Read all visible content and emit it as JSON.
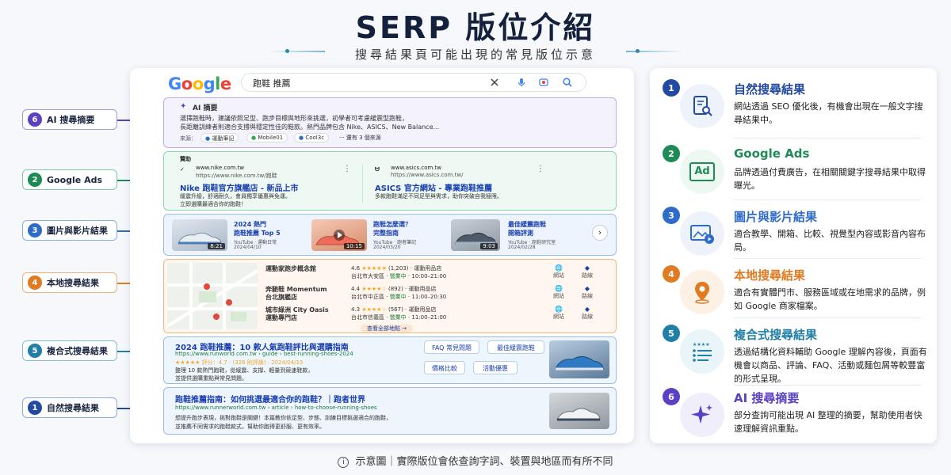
{
  "header": {
    "title": "SERP 版位介紹",
    "subtitle": "搜尋結果頁可能出現的常見版位示意"
  },
  "serp": {
    "logo": "Google",
    "query": "跑鞋 推薦",
    "ai": {
      "heading": "AI 摘要",
      "line1": "選擇跑鞋時，建議依照足型、跑步目標與地形來挑選，初學者可考慮緩震型跑鞋，",
      "line2": "長距離訓練者則適合支撐與穩定性佳的鞋款。熱門品牌包含 Nike、ASICS、New Balance...",
      "sources_label": "來源：",
      "sources": [
        "運動筆記",
        "Mobile01",
        "Cool3c"
      ],
      "more": "還有 3 個來源"
    },
    "ads": {
      "label": "贊助",
      "items": [
        {
          "domain": "www.nike.com.tw",
          "url": "https://www.nike.com.tw/跑鞋",
          "title": "Nike 跑鞋官方旗艦店 - 新品上市",
          "desc1": "緩震升級，舒適耐久，會員獨享優惠與免運。",
          "desc2": "立即選購最適合你的跑鞋！"
        },
        {
          "domain": "www.asics.com.tw",
          "url": "https://www.asics.com.tw/",
          "title": "ASICS 官方網站 - 專業跑鞋推薦",
          "desc1": "多款跑鞋滿足不同足型與需求，助你突破自我極限。",
          "desc2": ""
        }
      ]
    },
    "videos": [
      {
        "title1": "2024 熱門",
        "title2": "跑鞋推薦 Top 5",
        "source": "YouTube · 運動日常",
        "date": "2024/04/10",
        "duration": "8:21"
      },
      {
        "title1": "跑鞋怎麼選？",
        "title2": "完整指南",
        "source": "YouTube · 跑者筆記",
        "date": "2024/03/20",
        "duration": "10:15"
      },
      {
        "title1": "最佳緩震跑鞋",
        "title2": "開箱評測",
        "source": "YouTube · 跑鞋研究室",
        "date": "2024/02/28",
        "duration": "9:03"
      }
    ],
    "local": {
      "places": [
        {
          "name1": "運動家跑步概念館",
          "name2": "",
          "rating": "4.6",
          "stars": "★★★★★",
          "reviews": "(1,203)",
          "type": "運動用品店",
          "addr": "台北市大安區",
          "status": "營業中",
          "hours": "10:00–21:00"
        },
        {
          "name1": "奔馳鞋 Momentum",
          "name2": "台北旗艦店",
          "rating": "4.4",
          "stars": "★★★★☆",
          "reviews": "(892)",
          "type": "運動用品店",
          "addr": "台北市中正區",
          "status": "營業中",
          "hours": "11:00–20:30"
        },
        {
          "name1": "城市綠洲 City Oasis",
          "name2": "運動專門店",
          "rating": "4.3",
          "stars": "★★★★☆",
          "reviews": "(567)",
          "type": "運動用品店",
          "addr": "台北市信義區",
          "status": "營業中",
          "hours": "11:00–21:00"
        }
      ],
      "web": "網站",
      "dir": "路線",
      "more": "查看全部地點 →"
    },
    "rich": {
      "title": "2024 跑鞋推薦：10 款人氣跑鞋評比與選購指南",
      "url": "https://www.runworld.com.tw › guide › best-running-shoes-2024",
      "rating_text": "★★★★★ 評分：4.7 · (326 則評論) · 2024/04/15",
      "desc1": "整理 10 款熱門跑鞋，從緩震、支撐、輕量到競速鞋款，",
      "desc2": "並提供選購重點與常見問題。",
      "chips": [
        "FAQ 常見問題",
        "最佳緩震跑鞋",
        "價格比較",
        "活動優惠"
      ]
    },
    "organic": {
      "title": "跑鞋推薦指南：如何挑選最適合你的跑鞋？｜跑者世界",
      "url": "https://www.runnerworld.com.tw › article › how-to-choose-running-shoes",
      "desc1": "想提升跑步表現，挑對跑鞋是關鍵！本篇教你依足型、步態、訓練目標挑選適合的跑鞋，",
      "desc2": "並推薦不同需求的跑鞋款式，幫助你跑得更舒服、更有效率。"
    }
  },
  "labels": [
    {
      "num": "6",
      "text": "AI 搜尋摘要",
      "color": "#5b3fc4"
    },
    {
      "num": "2",
      "text": "Google Ads",
      "color": "#1e8a56"
    },
    {
      "num": "3",
      "text": "圖片與影片結果",
      "color": "#2f6cc9"
    },
    {
      "num": "4",
      "text": "本地搜尋結果",
      "color": "#e07b22"
    },
    {
      "num": "5",
      "text": "複合式搜尋結果",
      "color": "#1f7fa6"
    },
    {
      "num": "1",
      "text": "自然搜尋結果",
      "color": "#234aa3"
    }
  ],
  "legend": [
    {
      "num": "1",
      "title": "自然搜尋結果",
      "desc": "網站透過 SEO 優化後，有機會出現在一般文字搜尋結果中。",
      "color": "#234aa3",
      "icon": "document-search-icon"
    },
    {
      "num": "2",
      "title": "Google Ads",
      "desc": "品牌透過付費廣告，在相關關鍵字搜尋結果中取得曝光。",
      "color": "#1e8a56",
      "icon": "ad-icon"
    },
    {
      "num": "3",
      "title": "圖片與影片結果",
      "desc": "適合教學、開箱、比較、視覺型內容或影音內容布局。",
      "color": "#2f6cc9",
      "icon": "image-video-icon"
    },
    {
      "num": "4",
      "title": "本地搜尋結果",
      "desc": "適合有實體門市、服務區域或在地需求的品牌，例如 Google 商家檔案。",
      "color": "#e07b22",
      "icon": "location-pin-icon"
    },
    {
      "num": "5",
      "title": "複合式搜尋結果",
      "desc": "透過結構化資料輔助 Google 理解內容後，頁面有機會以商品、評論、FAQ、活動或麵包屑等較豐富的形式呈現。",
      "color": "#1f7fa6",
      "icon": "rich-list-icon"
    },
    {
      "num": "6",
      "title": "AI 搜尋摘要",
      "desc": "部分查詢可能出現 AI 整理的摘要，幫助使用者快速理解資訊重點。",
      "color": "#5b3fc4",
      "icon": "sparkle-icon"
    }
  ],
  "footer": {
    "note": "示意圖｜實際版位會依查詢字詞、裝置與地區而有所不同"
  }
}
